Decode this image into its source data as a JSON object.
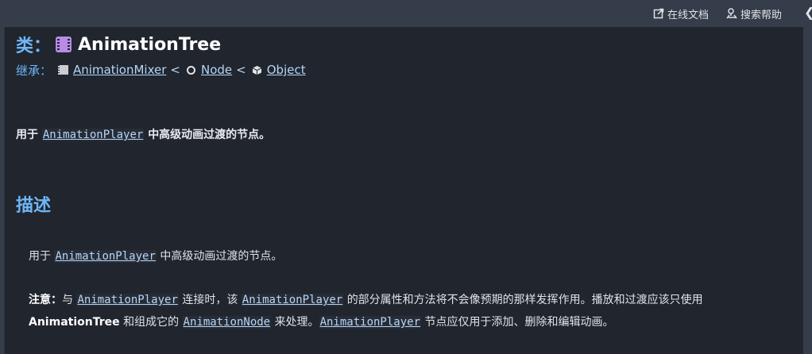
{
  "topbar": {
    "online_docs": "在线文档",
    "search_help": "搜索帮助",
    "collapse": "❮"
  },
  "class_header": {
    "prefix": "类：",
    "name": "AnimationTree",
    "inherits_label": "继承：",
    "parent1": "AnimationMixer",
    "sep1": "<",
    "parent2": "Node",
    "sep2": "<",
    "parent3": "Object"
  },
  "brief": {
    "pre": "用于",
    "link": "AnimationPlayer",
    "post": "中高级动画过渡的节点。"
  },
  "description": {
    "heading": "描述",
    "p1_pre": "用于",
    "p1_link": "AnimationPlayer",
    "p1_post": "中高级动画过渡的节点。",
    "note_label": "注意：",
    "n_1": "与",
    "n_link1": "AnimationPlayer",
    "n_2": "连接时，该",
    "n_link2": "AnimationPlayer",
    "n_3": "的部分属性和方法将不会像预期的那样发挥作用。播放和过渡应该只使用",
    "n_bold": "AnimationTree",
    "n_4": "和组成它的",
    "n_link3": "AnimationNode",
    "n_5": "来处理。",
    "n_link4": "AnimationPlayer",
    "n_6": "节点应仅用于添加、删除和编辑动画。"
  }
}
